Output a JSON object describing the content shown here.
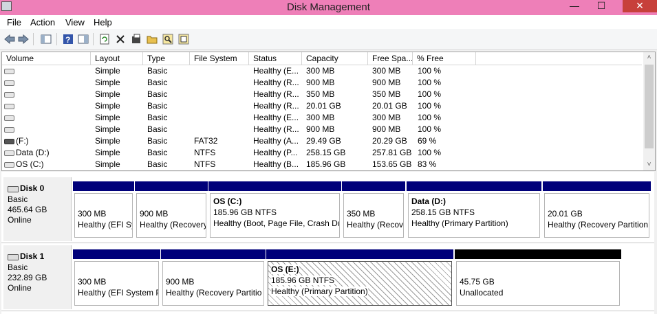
{
  "window": {
    "title": "Disk Management",
    "minimize": "—",
    "maximize": "☐",
    "close": "✕"
  },
  "menu": [
    "File",
    "Action",
    "View",
    "Help"
  ],
  "toolbar_icons": [
    "back-arrow-icon",
    "forward-arrow-icon",
    "console-tree-icon",
    "help-icon",
    "properties-panel-icon",
    "refresh-icon",
    "delete-icon",
    "properties-icon",
    "open-folder-icon",
    "search-icon",
    "export-icon"
  ],
  "volume_list": {
    "columns": [
      "Volume",
      "Layout",
      "Type",
      "File System",
      "Status",
      "Capacity",
      "Free Spa...",
      "% Free"
    ],
    "rows": [
      {
        "volume": "",
        "layout": "Simple",
        "type": "Basic",
        "fs": "",
        "status": "Healthy (E...",
        "capacity": "300 MB",
        "free": "300 MB",
        "pct": "100 %",
        "icon": "light"
      },
      {
        "volume": "",
        "layout": "Simple",
        "type": "Basic",
        "fs": "",
        "status": "Healthy (R...",
        "capacity": "900 MB",
        "free": "900 MB",
        "pct": "100 %",
        "icon": "light"
      },
      {
        "volume": "",
        "layout": "Simple",
        "type": "Basic",
        "fs": "",
        "status": "Healthy (R...",
        "capacity": "350 MB",
        "free": "350 MB",
        "pct": "100 %",
        "icon": "light"
      },
      {
        "volume": "",
        "layout": "Simple",
        "type": "Basic",
        "fs": "",
        "status": "Healthy (R...",
        "capacity": "20.01 GB",
        "free": "20.01 GB",
        "pct": "100 %",
        "icon": "light"
      },
      {
        "volume": "",
        "layout": "Simple",
        "type": "Basic",
        "fs": "",
        "status": "Healthy (E...",
        "capacity": "300 MB",
        "free": "300 MB",
        "pct": "100 %",
        "icon": "light"
      },
      {
        "volume": "",
        "layout": "Simple",
        "type": "Basic",
        "fs": "",
        "status": "Healthy (R...",
        "capacity": "900 MB",
        "free": "900 MB",
        "pct": "100 %",
        "icon": "light"
      },
      {
        "volume": "(F:)",
        "layout": "Simple",
        "type": "Basic",
        "fs": "FAT32",
        "status": "Healthy (A...",
        "capacity": "29.49 GB",
        "free": "20.29 GB",
        "pct": "69 %",
        "icon": "dark"
      },
      {
        "volume": "Data (D:)",
        "layout": "Simple",
        "type": "Basic",
        "fs": "NTFS",
        "status": "Healthy (P...",
        "capacity": "258.15 GB",
        "free": "257.81 GB",
        "pct": "100 %",
        "icon": "light"
      },
      {
        "volume": "OS (C:)",
        "layout": "Simple",
        "type": "Basic",
        "fs": "NTFS",
        "status": "Healthy (B...",
        "capacity": "185.96 GB",
        "free": "153.65 GB",
        "pct": "83 %",
        "icon": "light"
      }
    ],
    "scroll_up": "˄",
    "scroll_down": "˅"
  },
  "disks": [
    {
      "name": "Disk 0",
      "type": "Basic",
      "size": "465.64 GB",
      "status": "Online",
      "partitions": [
        {
          "label": "",
          "line1": "300 MB",
          "line2": "Healthy (EFI Sy"
        },
        {
          "label": "",
          "line1": "900 MB",
          "line2": "Healthy (Recovery"
        },
        {
          "label": "OS  (C:)",
          "line1": "185.96 GB NTFS",
          "line2": "Healthy (Boot, Page File, Crash Du"
        },
        {
          "label": "",
          "line1": "350 MB",
          "line2": "Healthy (Recov"
        },
        {
          "label": "Data  (D:)",
          "line1": "258.15 GB NTFS",
          "line2": "Healthy (Primary Partition)"
        },
        {
          "label": "",
          "line1": "20.01 GB",
          "line2": "Healthy (Recovery Partition"
        }
      ]
    },
    {
      "name": "Disk 1",
      "type": "Basic",
      "size": "232.89 GB",
      "status": "Online",
      "partitions": [
        {
          "label": "",
          "line1": "300 MB",
          "line2": "Healthy (EFI System P"
        },
        {
          "label": "",
          "line1": "900 MB",
          "line2": "Healthy (Recovery Partitio"
        },
        {
          "label": "OS  (E:)",
          "line1": "185.96 GB NTFS",
          "line2": "Healthy (Primary Partition)"
        },
        {
          "label": "",
          "line1": "45.75 GB",
          "line2": "Unallocated"
        }
      ]
    }
  ]
}
